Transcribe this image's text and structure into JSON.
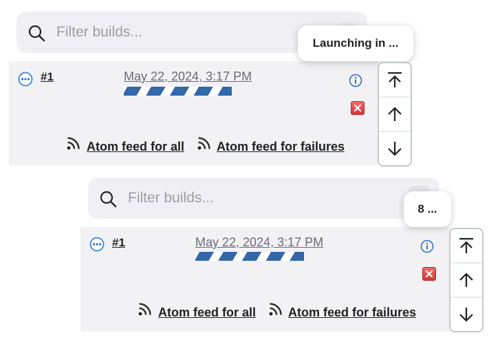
{
  "panels": [
    {
      "search": {
        "placeholder": "Filter builds..."
      },
      "tooltip": "Launching in ...",
      "build": {
        "number": "#1",
        "date": "May 22, 2024, 3:17 PM",
        "progress": 1.0
      },
      "feeds": {
        "all": "Atom feed for all",
        "failures": "Atom feed for failures"
      },
      "nav": [
        "scroll-to-top",
        "scroll-up",
        "scroll-down"
      ]
    },
    {
      "search": {
        "placeholder": "Filter builds..."
      },
      "tooltip": "8 ...",
      "build": {
        "number": "#1",
        "date": "May 22, 2024, 3:17 PM",
        "progress": 1.0
      },
      "feeds": {
        "all": "Atom feed for all",
        "failures": "Atom feed for failures"
      },
      "nav": [
        "scroll-to-top",
        "scroll-up",
        "scroll-down"
      ]
    }
  ],
  "colors": {
    "accent": "#3467a8",
    "status_icon": "#4a90d9",
    "cancel": "#e04848",
    "panel_bg": "#f2f2f5"
  }
}
